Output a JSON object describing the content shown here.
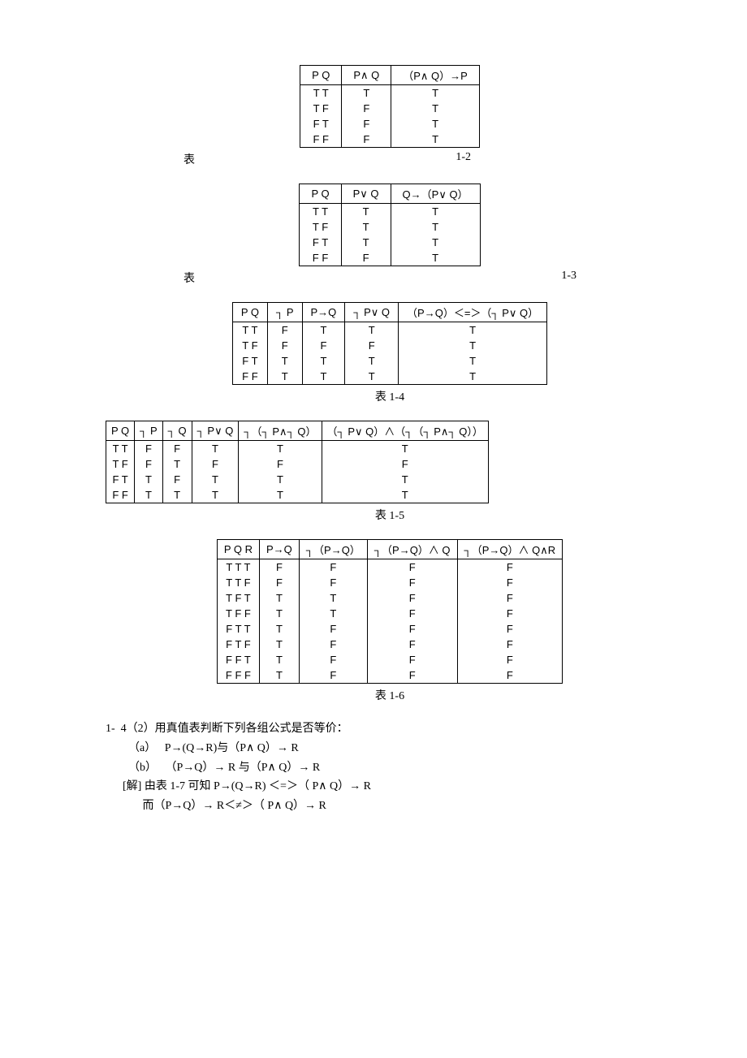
{
  "labels": {
    "biao": "表",
    "t12": "1-2",
    "t13": "1-3",
    "t14": "表 1-4",
    "t15": "表 1-5",
    "t16": "表 1-6"
  },
  "t12": {
    "headers": [
      "P   Q",
      "P∧ Q",
      "（P∧ Q）→P"
    ],
    "rows": [
      [
        "T  T",
        "T",
        "T"
      ],
      [
        "T  F",
        "F",
        "T"
      ],
      [
        "F  T",
        "F",
        "T"
      ],
      [
        "F  F",
        "F",
        "T"
      ]
    ]
  },
  "t13": {
    "headers": [
      "P   Q",
      "P∨ Q",
      "Q→（P∨ Q）"
    ],
    "rows": [
      [
        "T  T",
        "T",
        "T"
      ],
      [
        "T  F",
        "T",
        "T"
      ],
      [
        "F  T",
        "T",
        "T"
      ],
      [
        "F  F",
        "F",
        "T"
      ]
    ]
  },
  "t14": {
    "headers": [
      "P   Q",
      "┐ P",
      "P→Q",
      "┐ P∨ Q",
      "（P→Q）＜=＞（┐  P∨ Q）"
    ],
    "rows": [
      [
        "T  T",
        "F",
        "T",
        "T",
        "T"
      ],
      [
        "T  F",
        "F",
        "F",
        "F",
        "T"
      ],
      [
        "F  T",
        "T",
        "T",
        "T",
        "T"
      ],
      [
        "F  F",
        "T",
        "T",
        "T",
        "T"
      ]
    ]
  },
  "t15": {
    "headers": [
      "P   Q",
      "┐ P",
      "┐ Q",
      "┐ P∨ Q",
      "┐（┐ P∧┐ Q）",
      "（┐ P∨ Q）∧（┐（┐ P∧┐ Q））"
    ],
    "rows": [
      [
        "T  T",
        "F",
        "F",
        "T",
        "T",
        "T"
      ],
      [
        "T  F",
        "F",
        "T",
        "F",
        "F",
        "F"
      ],
      [
        "F  T",
        "T",
        "F",
        "T",
        "T",
        "T"
      ],
      [
        "F  F",
        "T",
        "T",
        "T",
        "T",
        "T"
      ]
    ]
  },
  "t16": {
    "headers": [
      "P   Q  R",
      "P→Q",
      "┐（P→Q）",
      "┐（P→Q）∧ Q",
      "┐（P→Q）∧ Q∧R"
    ],
    "rows": [
      [
        "T  T  T",
        "F",
        "F",
        "F",
        "F"
      ],
      [
        "T  T  F",
        "F",
        "F",
        "F",
        "F"
      ],
      [
        "T  F  T",
        "T",
        "T",
        "F",
        "F"
      ],
      [
        "T  F  F",
        "T",
        "T",
        "F",
        "F"
      ],
      [
        "F  T  T",
        "T",
        "F",
        "F",
        "F"
      ],
      [
        "F  T  F",
        "T",
        "F",
        "F",
        "F"
      ],
      [
        "F  F  T",
        "T",
        "F",
        "F",
        "F"
      ],
      [
        "F  F  F",
        "T",
        "F",
        "F",
        "F"
      ]
    ]
  },
  "text": {
    "l1": "1-  4（2）用真值表判断下列各组公式是否等价：",
    "l2": "        （a）   P→(Q→R)与（P∧ Q）→ R",
    "l3": "        （b）   （P→Q）→ R 与（P∧ Q）→ R",
    "l4": "      [解] 由表 1-7 可知 P→(Q→R) ＜=＞（ P∧ Q）→ R",
    "l5": "             而（P→Q）→ R＜≠＞（ P∧ Q）→ R"
  }
}
